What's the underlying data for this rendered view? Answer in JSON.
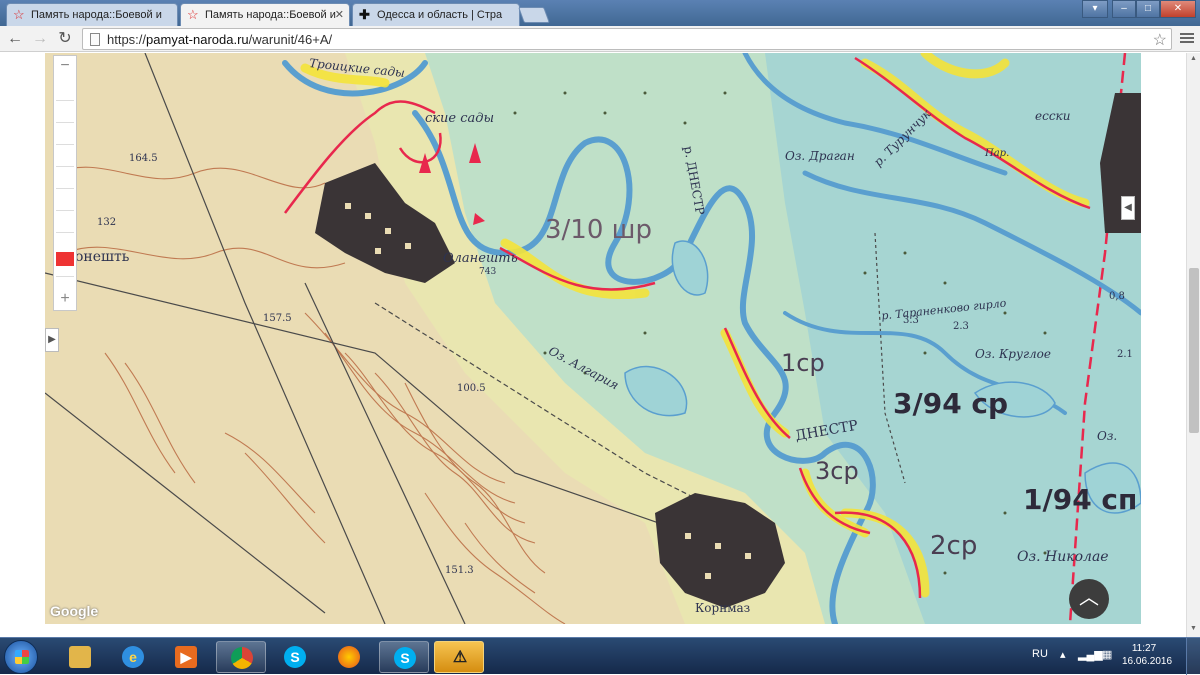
{
  "browser": {
    "tabs": [
      {
        "title": "Память народа::Боевой и",
        "icon": "star-icon",
        "active": false
      },
      {
        "title": "Память народа::Боевой и",
        "icon": "star-icon",
        "active": true
      },
      {
        "title": "Одесса и область | Стра",
        "icon": "cross-icon",
        "active": false
      }
    ],
    "url": "https://pamyat-naroda.ru/warunit/46+A/",
    "url_scheme": "https://",
    "url_host": "pamyat-naroda.ru",
    "url_path": "/warunit/46+A/"
  },
  "map": {
    "provider_logo": "Google",
    "labels": {
      "olaneshty_top": "Оланешть",
      "olaneshty_left": "онешть",
      "dnestr_1": "р. ДНЕСТР",
      "dnestr_2": "ДНЕСТР",
      "turunchuk": "р. Турунчук",
      "lake_dragan": "Оз. Драган",
      "lake_algarya": "Оз. Алгария",
      "lake_krugloe": "Оз. Круглое",
      "lake_nikolaev": "Оз. Николае",
      "lake_oz": "Оз.",
      "taranenkovo": "р. Тараненково гирло",
      "troitskie_sady": "Троицкие сады",
      "sady": "ские сады",
      "kornmaz": "Корнмаз",
      "unit_3_10": "3/10 шр",
      "unit_1cp": "1ср",
      "unit_3_94": "3/94 ср",
      "unit_3cp": "3ср",
      "unit_1_94": "1/94 сп",
      "unit_2cp": "2ср",
      "elev_164": "164.5",
      "elev_132": "132",
      "elev_157": "157.5",
      "elev_100": "100.5",
      "elev_151": "151.3",
      "elev_743": "743",
      "elev_3_3": "3.3",
      "elev_2_3": "2.3",
      "elev_0_8": "0,8",
      "elev_2_1": "2.1",
      "pier": "Пар.",
      "essky": "есски"
    }
  },
  "taskbar": {
    "items": [
      {
        "name": "explorer-icon",
        "open": false
      },
      {
        "name": "ie-icon",
        "open": false
      },
      {
        "name": "media-player-icon",
        "open": false
      },
      {
        "name": "chrome-icon",
        "open": true
      },
      {
        "name": "skype-icon",
        "open": false
      },
      {
        "name": "firefox-icon",
        "open": false
      },
      {
        "name": "skype-icon-2",
        "open": true
      },
      {
        "name": "warning-icon",
        "open": true
      }
    ],
    "language": "RU",
    "time": "11:27",
    "date": "16.06.2016"
  },
  "colors": {
    "river": "#5a9fcf",
    "water_fill": "#9fd3d6",
    "land": "#e9e6b0",
    "settlement": "#3a3436",
    "front_line": "#e8284d",
    "highlight": "#f4e33a",
    "contour": "#c07a52"
  }
}
